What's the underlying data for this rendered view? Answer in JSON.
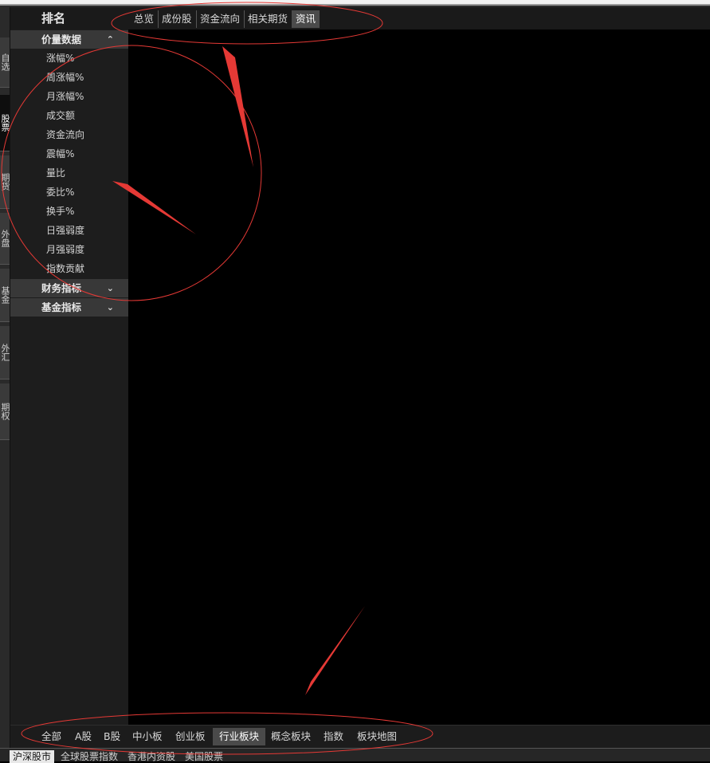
{
  "left_rail": {
    "tabs": [
      {
        "label": "自选",
        "active": false
      },
      {
        "label": "股票",
        "active": true
      },
      {
        "label": "期货",
        "active": false
      },
      {
        "label": "外盘",
        "active": false
      },
      {
        "label": "基金",
        "active": false
      },
      {
        "label": "外汇",
        "active": false
      },
      {
        "label": "期权",
        "active": false
      }
    ]
  },
  "sidebar": {
    "title": "排名",
    "sections": [
      {
        "label": "价量数据",
        "chevron": "chevron-up-icon",
        "chev_glyph": "⌃"
      },
      {
        "label": "财务指标",
        "chevron": "chevron-down-icon",
        "chev_glyph": "⌄"
      },
      {
        "label": "基金指标",
        "chevron": "chevron-down-icon",
        "chev_glyph": "⌄"
      }
    ],
    "items": [
      "涨幅%",
      "周涨幅%",
      "月涨幅%",
      "成交额",
      "资金流向",
      "震幅%",
      "量比",
      "委比%",
      "换手%",
      "日强弱度",
      "月强弱度",
      "指数贡献"
    ]
  },
  "top_tabs": [
    {
      "label": "总览"
    },
    {
      "label": "成份股"
    },
    {
      "label": "资金流向"
    },
    {
      "label": "相关期货"
    },
    {
      "label": "资讯"
    }
  ],
  "top_tabs_active": "资讯",
  "bottom_tabs": [
    {
      "label": "全部"
    },
    {
      "label": "A股"
    },
    {
      "label": "B股"
    },
    {
      "label": "中小板"
    },
    {
      "label": "创业板"
    },
    {
      "label": "行业板块"
    },
    {
      "label": "概念板块"
    },
    {
      "label": "指数"
    },
    {
      "label": "板块地图"
    }
  ],
  "bottom_tabs_active": "行业板块",
  "status_tabs": [
    {
      "label": "沪深股市"
    },
    {
      "label": "全球股票指数"
    },
    {
      "label": "香港内资股"
    },
    {
      "label": "美国股票"
    }
  ],
  "status_tabs_active": "沪深股市",
  "colors": {
    "annotation": "#e53935",
    "background": "#000000",
    "active_tab": "#4b4b4b"
  }
}
